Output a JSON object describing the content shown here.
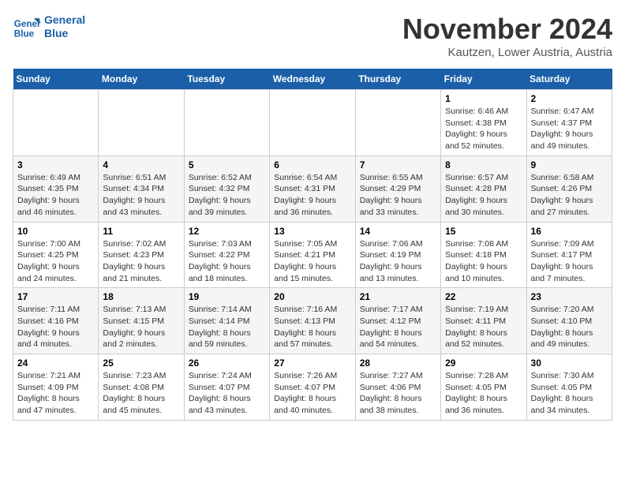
{
  "logo": {
    "line1": "General",
    "line2": "Blue"
  },
  "title": "November 2024",
  "location": "Kautzen, Lower Austria, Austria",
  "days_of_week": [
    "Sunday",
    "Monday",
    "Tuesday",
    "Wednesday",
    "Thursday",
    "Friday",
    "Saturday"
  ],
  "weeks": [
    [
      {
        "day": "",
        "info": ""
      },
      {
        "day": "",
        "info": ""
      },
      {
        "day": "",
        "info": ""
      },
      {
        "day": "",
        "info": ""
      },
      {
        "day": "",
        "info": ""
      },
      {
        "day": "1",
        "info": "Sunrise: 6:46 AM\nSunset: 4:38 PM\nDaylight: 9 hours and 52 minutes."
      },
      {
        "day": "2",
        "info": "Sunrise: 6:47 AM\nSunset: 4:37 PM\nDaylight: 9 hours and 49 minutes."
      }
    ],
    [
      {
        "day": "3",
        "info": "Sunrise: 6:49 AM\nSunset: 4:35 PM\nDaylight: 9 hours and 46 minutes."
      },
      {
        "day": "4",
        "info": "Sunrise: 6:51 AM\nSunset: 4:34 PM\nDaylight: 9 hours and 43 minutes."
      },
      {
        "day": "5",
        "info": "Sunrise: 6:52 AM\nSunset: 4:32 PM\nDaylight: 9 hours and 39 minutes."
      },
      {
        "day": "6",
        "info": "Sunrise: 6:54 AM\nSunset: 4:31 PM\nDaylight: 9 hours and 36 minutes."
      },
      {
        "day": "7",
        "info": "Sunrise: 6:55 AM\nSunset: 4:29 PM\nDaylight: 9 hours and 33 minutes."
      },
      {
        "day": "8",
        "info": "Sunrise: 6:57 AM\nSunset: 4:28 PM\nDaylight: 9 hours and 30 minutes."
      },
      {
        "day": "9",
        "info": "Sunrise: 6:58 AM\nSunset: 4:26 PM\nDaylight: 9 hours and 27 minutes."
      }
    ],
    [
      {
        "day": "10",
        "info": "Sunrise: 7:00 AM\nSunset: 4:25 PM\nDaylight: 9 hours and 24 minutes."
      },
      {
        "day": "11",
        "info": "Sunrise: 7:02 AM\nSunset: 4:23 PM\nDaylight: 9 hours and 21 minutes."
      },
      {
        "day": "12",
        "info": "Sunrise: 7:03 AM\nSunset: 4:22 PM\nDaylight: 9 hours and 18 minutes."
      },
      {
        "day": "13",
        "info": "Sunrise: 7:05 AM\nSunset: 4:21 PM\nDaylight: 9 hours and 15 minutes."
      },
      {
        "day": "14",
        "info": "Sunrise: 7:06 AM\nSunset: 4:19 PM\nDaylight: 9 hours and 13 minutes."
      },
      {
        "day": "15",
        "info": "Sunrise: 7:08 AM\nSunset: 4:18 PM\nDaylight: 9 hours and 10 minutes."
      },
      {
        "day": "16",
        "info": "Sunrise: 7:09 AM\nSunset: 4:17 PM\nDaylight: 9 hours and 7 minutes."
      }
    ],
    [
      {
        "day": "17",
        "info": "Sunrise: 7:11 AM\nSunset: 4:16 PM\nDaylight: 9 hours and 4 minutes."
      },
      {
        "day": "18",
        "info": "Sunrise: 7:13 AM\nSunset: 4:15 PM\nDaylight: 9 hours and 2 minutes."
      },
      {
        "day": "19",
        "info": "Sunrise: 7:14 AM\nSunset: 4:14 PM\nDaylight: 8 hours and 59 minutes."
      },
      {
        "day": "20",
        "info": "Sunrise: 7:16 AM\nSunset: 4:13 PM\nDaylight: 8 hours and 57 minutes."
      },
      {
        "day": "21",
        "info": "Sunrise: 7:17 AM\nSunset: 4:12 PM\nDaylight: 8 hours and 54 minutes."
      },
      {
        "day": "22",
        "info": "Sunrise: 7:19 AM\nSunset: 4:11 PM\nDaylight: 8 hours and 52 minutes."
      },
      {
        "day": "23",
        "info": "Sunrise: 7:20 AM\nSunset: 4:10 PM\nDaylight: 8 hours and 49 minutes."
      }
    ],
    [
      {
        "day": "24",
        "info": "Sunrise: 7:21 AM\nSunset: 4:09 PM\nDaylight: 8 hours and 47 minutes."
      },
      {
        "day": "25",
        "info": "Sunrise: 7:23 AM\nSunset: 4:08 PM\nDaylight: 8 hours and 45 minutes."
      },
      {
        "day": "26",
        "info": "Sunrise: 7:24 AM\nSunset: 4:07 PM\nDaylight: 8 hours and 43 minutes."
      },
      {
        "day": "27",
        "info": "Sunrise: 7:26 AM\nSunset: 4:07 PM\nDaylight: 8 hours and 40 minutes."
      },
      {
        "day": "28",
        "info": "Sunrise: 7:27 AM\nSunset: 4:06 PM\nDaylight: 8 hours and 38 minutes."
      },
      {
        "day": "29",
        "info": "Sunrise: 7:28 AM\nSunset: 4:05 PM\nDaylight: 8 hours and 36 minutes."
      },
      {
        "day": "30",
        "info": "Sunrise: 7:30 AM\nSunset: 4:05 PM\nDaylight: 8 hours and 34 minutes."
      }
    ]
  ]
}
